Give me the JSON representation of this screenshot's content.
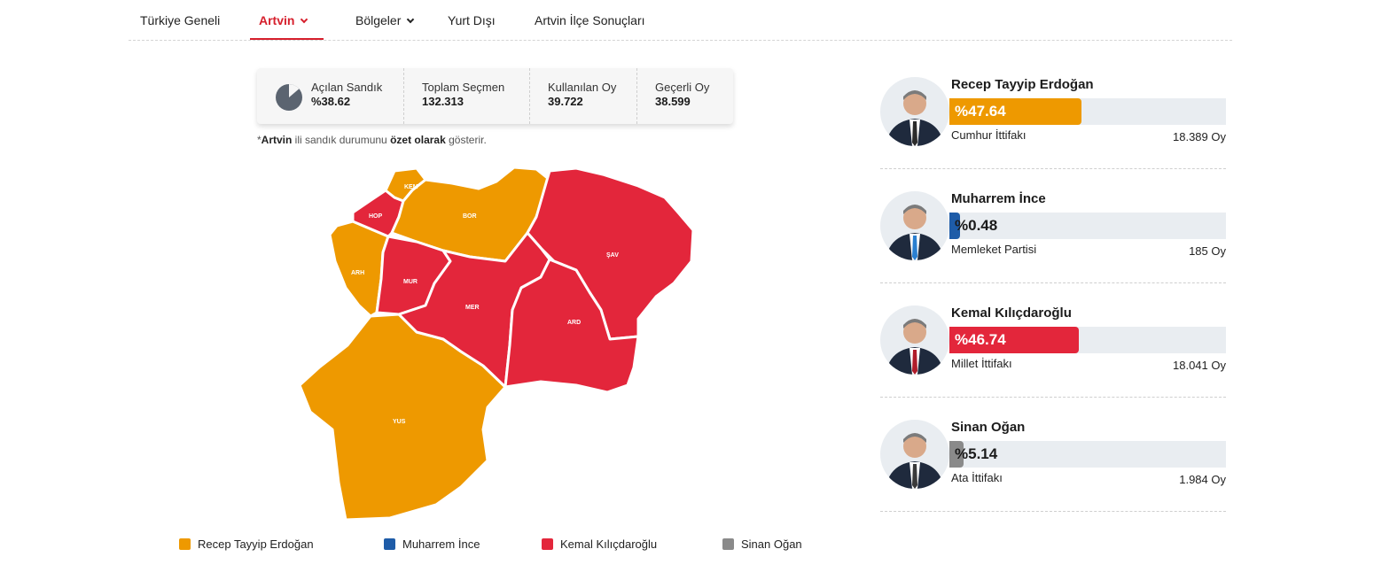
{
  "nav": {
    "items": [
      {
        "label": "Türkiye Geneli"
      },
      {
        "label": "Artvin"
      },
      {
        "label": "Bölgeler"
      },
      {
        "label": "Yurt Dışı"
      },
      {
        "label": "Artvin İlçe Sonuçları"
      }
    ]
  },
  "stats": {
    "opened_label": "Açılan Sandık",
    "opened_value": "%38.62",
    "opened_fraction": 0.3862,
    "total_label": "Toplam Seçmen",
    "total_value": "132.313",
    "used_label": "Kullanılan Oy",
    "used_value": "39.722",
    "valid_label": "Geçerli Oy",
    "valid_value": "38.599"
  },
  "note": {
    "prefix": "*",
    "province": "Artvin",
    "part1": " ili sandık durumunu ",
    "bold": "özet olarak",
    "part2": " gösterir."
  },
  "map": {
    "districts": [
      {
        "code": "KEM",
        "winner": "erdogan"
      },
      {
        "code": "HOP",
        "winner": "kilicdaroglu"
      },
      {
        "code": "BOR",
        "winner": "erdogan"
      },
      {
        "code": "ŞAV",
        "winner": "kilicdaroglu"
      },
      {
        "code": "ARH",
        "winner": "erdogan"
      },
      {
        "code": "MUR",
        "winner": "kilicdaroglu"
      },
      {
        "code": "MER",
        "winner": "kilicdaroglu"
      },
      {
        "code": "ARD",
        "winner": "kilicdaroglu"
      },
      {
        "code": "YUS",
        "winner": "erdogan"
      }
    ]
  },
  "colors": {
    "erdogan": "#ee9900",
    "ince": "#1e5ca8",
    "kilicdaroglu": "#e3263b",
    "ogan": "#8a8a8a",
    "accent": "#d61f2c"
  },
  "legend": [
    {
      "label": "Recep Tayyip Erdoğan",
      "color": "#ee9900"
    },
    {
      "label": "Muharrem İnce",
      "color": "#1e5ca8"
    },
    {
      "label": "Kemal Kılıçdaroğlu",
      "color": "#e3263b"
    },
    {
      "label": "Sinan Oğan",
      "color": "#8a8a8a"
    }
  ],
  "candidates": [
    {
      "name": "Recep Tayyip Erdoğan",
      "pct_label": "%47.64",
      "pct": 47.64,
      "party": "Cumhur İttifakı",
      "votes": "18.389 Oy",
      "color": "#ee9900",
      "tie": "#2b2b2b",
      "pct_color": "#ffffff"
    },
    {
      "name": "Muharrem İnce",
      "pct_label": "%0.48",
      "pct": 0.48,
      "party": "Memleket Partisi",
      "votes": "185 Oy",
      "color": "#1e5ca8",
      "tie": "#2a7fd0",
      "pct_color": "#1b1b1b"
    },
    {
      "name": "Kemal Kılıçdaroğlu",
      "pct_label": "%46.74",
      "pct": 46.74,
      "party": "Millet İttifakı",
      "votes": "18.041 Oy",
      "color": "#e3263b",
      "tie": "#b01c2a",
      "pct_color": "#ffffff"
    },
    {
      "name": "Sinan Oğan",
      "pct_label": "%5.14",
      "pct": 5.14,
      "party": "Ata İttifakı",
      "votes": "1.984 Oy",
      "color": "#8a8a8a",
      "tie": "#3a3a3a",
      "pct_color": "#1b1b1b"
    }
  ]
}
